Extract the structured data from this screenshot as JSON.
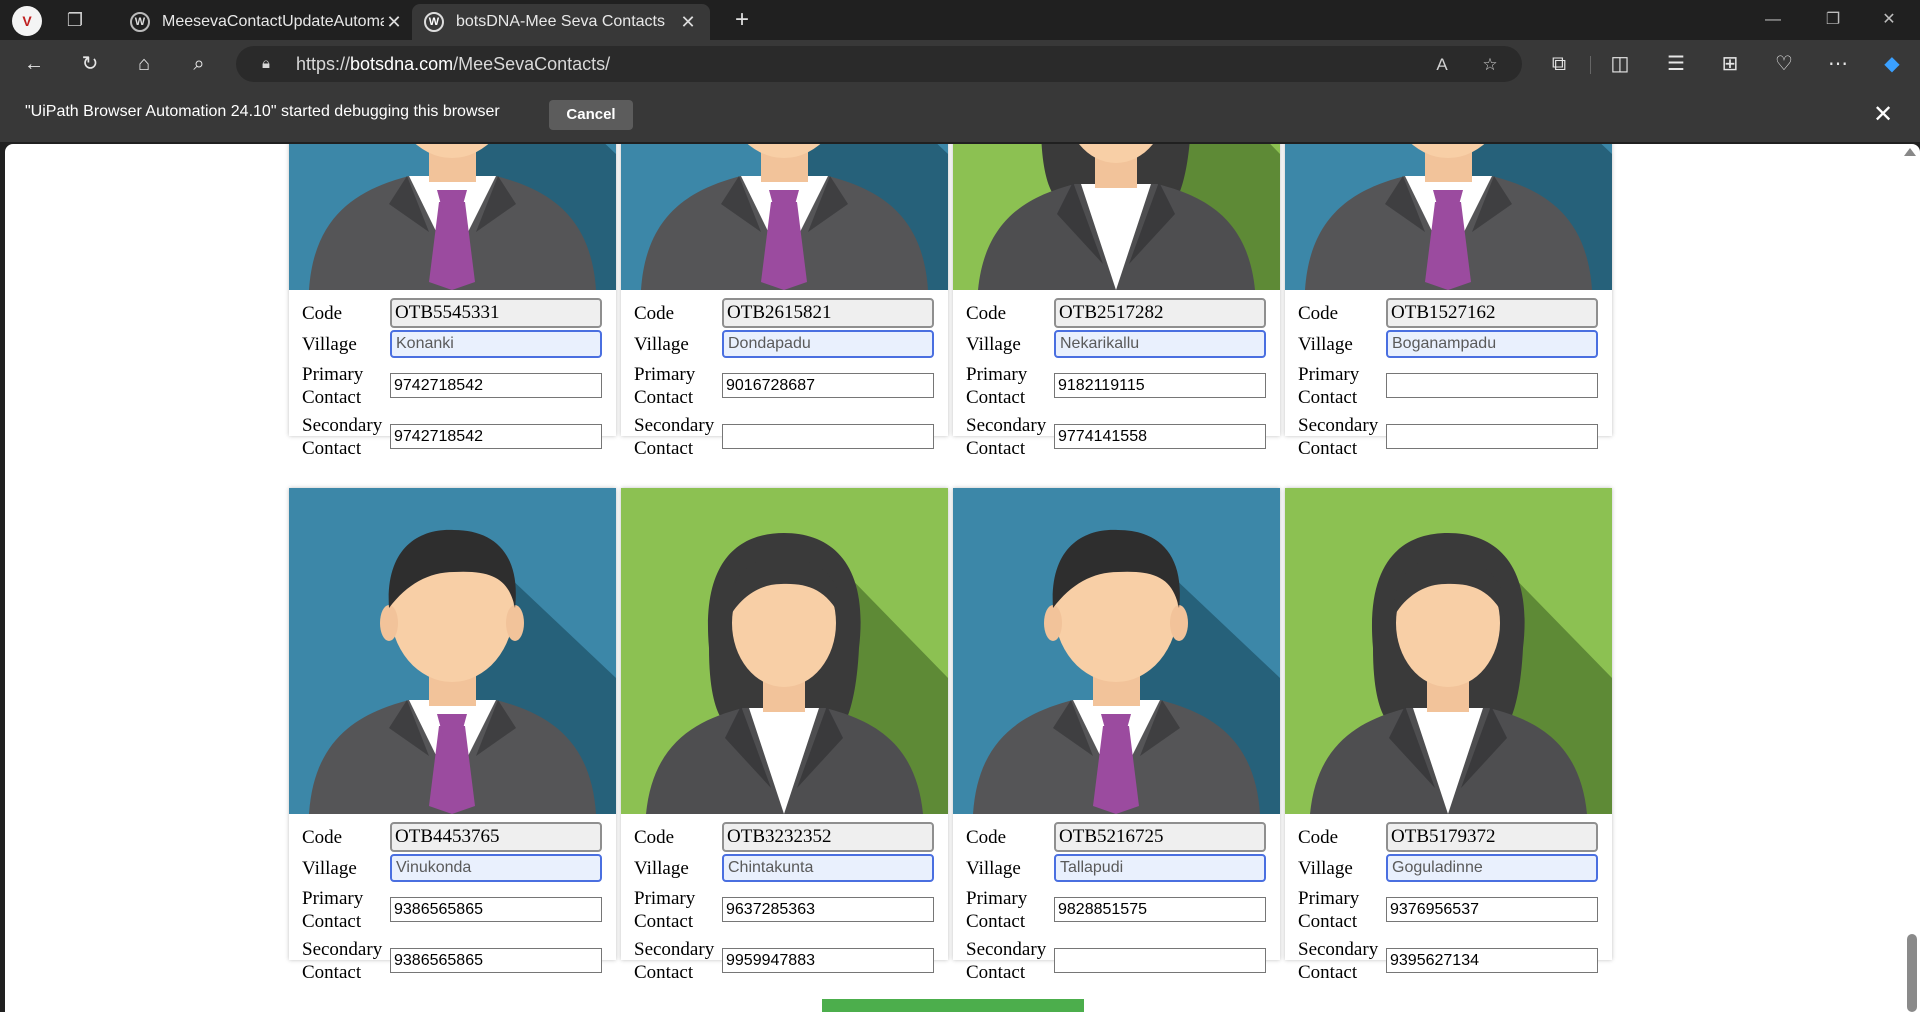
{
  "browser": {
    "profile_initial": "V",
    "tabs": [
      {
        "title": "MeesevaContactUpdateAutomat",
        "active": false
      },
      {
        "title": "botsDNA-Mee Seva Contacts",
        "active": true
      }
    ],
    "url_prefix": "https://",
    "url_host": "botsdna.com",
    "url_path": "/MeeSevaContacts/"
  },
  "infobar": {
    "message": "\"UiPath Browser Automation 24.10\" started debugging this browser",
    "cancel_label": "Cancel"
  },
  "labels": {
    "code": "Code",
    "village": "Village",
    "primary_1": "Primary",
    "primary_2": "Contact",
    "secondary_1": "Secondary",
    "secondary_2": "Contact"
  },
  "contacts": [
    {
      "code": "OTB5545331",
      "village": "Konanki",
      "primary": "9742718542",
      "secondary": "9742718542",
      "avatar": "male"
    },
    {
      "code": "OTB2615821",
      "village": "Dondapadu",
      "primary": "9016728687",
      "secondary": "",
      "avatar": "male"
    },
    {
      "code": "OTB2517282",
      "village": "Nekarikallu",
      "primary": "9182119115",
      "secondary": "9774141558",
      "avatar": "female"
    },
    {
      "code": "OTB1527162",
      "village": "Boganampadu",
      "primary": "",
      "secondary": "",
      "avatar": "male"
    },
    {
      "code": "OTB4453765",
      "village": "Vinukonda",
      "primary": "9386565865",
      "secondary": "9386565865",
      "avatar": "male"
    },
    {
      "code": "OTB3232352",
      "village": "Chintakunta",
      "primary": "9637285363",
      "secondary": "9959947883",
      "avatar": "female"
    },
    {
      "code": "OTB5216725",
      "village": "Tallapudi",
      "primary": "9828851575",
      "secondary": "",
      "avatar": "male"
    },
    {
      "code": "OTB5179372",
      "village": "Goguladinne",
      "primary": "9376956537",
      "secondary": "9395627134",
      "avatar": "female"
    }
  ],
  "colors": {
    "male_bg": "#3c87a8",
    "male_shadow": "#26617a",
    "female_bg": "#8cc152",
    "female_shadow": "#5e8a36",
    "tie": "#9b4b9f",
    "village_highlight": "#4a6fe0",
    "submit_button": "#4cae4c"
  }
}
